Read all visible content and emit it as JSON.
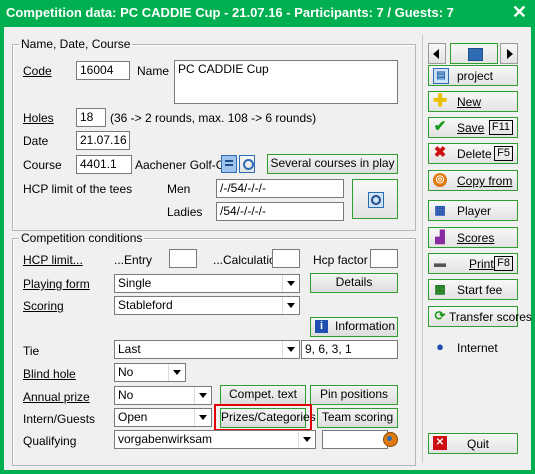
{
  "window": {
    "title": "Competition data: PC CADDIE Cup - 21.07.16 - Participants: 7 / Guests: 7",
    "close": "✕"
  },
  "name_group": {
    "legend": "Name, Date, Course",
    "code_label": "Code",
    "code_value": "16004",
    "name_label": "Name",
    "name_value": "PC CADDIE Cup",
    "holes_label": "Holes",
    "holes_value": "18",
    "holes_hint": "(36 -> 2 rounds, max. 108 -> 6 rounds)",
    "date_label": "Date",
    "date_value": "21.07.16",
    "course_label": "Course",
    "course_value": "4401.1",
    "course_name": "Aachener Golf-Clu",
    "several_courses_button": "Several courses in play",
    "hcp_limit_label": "HCP limit of the tees",
    "men_label": "Men",
    "men_value": "/-/54/-/-/-",
    "ladies_label": "Ladies",
    "ladies_value": "/54/-/-/-/-"
  },
  "conditions": {
    "legend": "Competition conditions",
    "hcp_limit_label": "HCP limit...",
    "entry_label": "...Entry",
    "entry_value": "",
    "calc_label": "...Calculation",
    "calc_value": "",
    "hcp_factor_label": "Hcp factor",
    "hcp_factor_value": "",
    "playing_form_label": "Playing form",
    "playing_form_value": "Single",
    "details_button": "Details",
    "scoring_label": "Scoring",
    "scoring_value": "Stableford",
    "information_button": "Information",
    "tie_label": "Tie",
    "tie_value": "Last",
    "tie_extra": "9, 6, 3, 1",
    "blind_hole_label": "Blind hole",
    "blind_hole_value": "No",
    "annual_prize_label": "Annual prize",
    "annual_prize_value": "No",
    "compet_text_button": "Compet. text",
    "pin_positions_button": "Pin positions",
    "intern_guests_label": "Intern/Guests",
    "intern_guests_value": "Open",
    "prizes_button": "Prizes/Categories",
    "team_scoring_button": "Team scoring",
    "qualifying_label": "Qualifying",
    "qualifying_value": "vorgabenwirksam",
    "qualifying_extra": ""
  },
  "sidebar": {
    "project": "project",
    "new": "New",
    "save": "Save",
    "save_key": "F11",
    "delete": "Delete",
    "delete_key": "F5",
    "copy_from": "Copy from",
    "player": "Player",
    "scores": "Scores",
    "print": "Print",
    "print_key": "F8",
    "start_fee": "Start fee",
    "transfer_scores": "Transfer scores",
    "internet": "Internet",
    "quit": "Quit"
  },
  "colors": {
    "title_bar": "#00b050",
    "highlight": "#e0000a"
  }
}
